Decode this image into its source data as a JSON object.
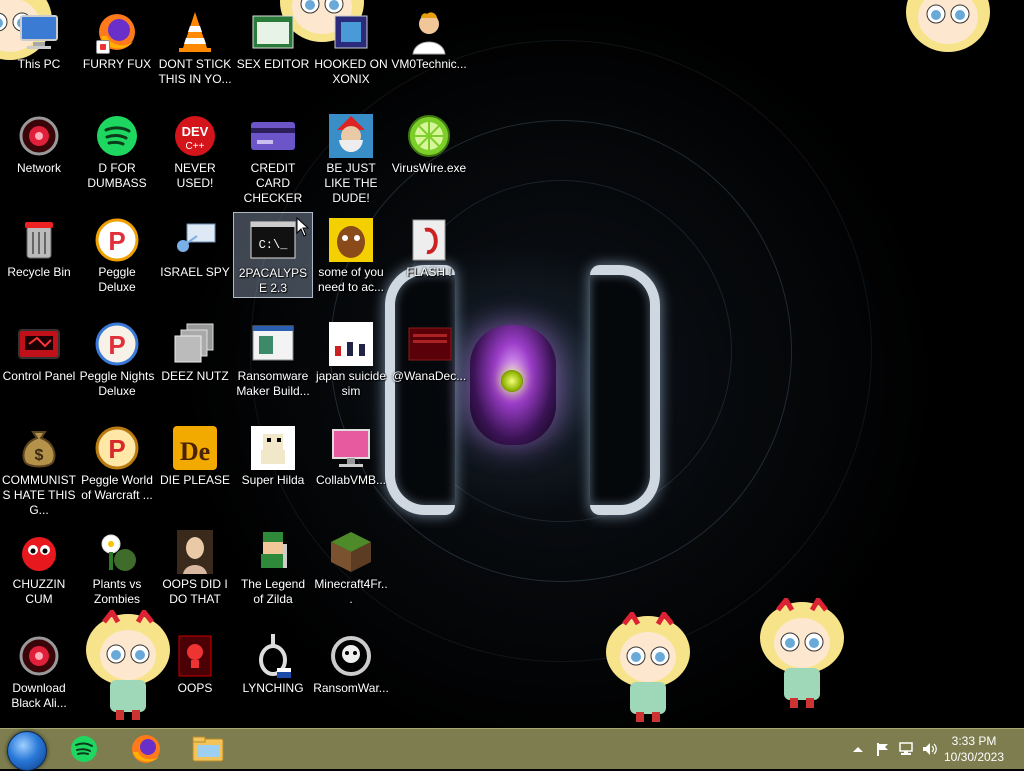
{
  "desktop": {
    "icons": [
      {
        "label": "This PC",
        "icon": "computer-icon"
      },
      {
        "label": "Network",
        "icon": "network-icon"
      },
      {
        "label": "Recycle Bin",
        "icon": "recycle-bin-icon"
      },
      {
        "label": "Control Panel",
        "icon": "control-panel-icon"
      },
      {
        "label": "COMMUNISTS HATE THIS G...",
        "icon": "money-bag-icon"
      },
      {
        "label": "CHUZZIN CUM",
        "icon": "chuzzle-icon"
      },
      {
        "label": "Download Black Ali...",
        "icon": "red-orb-icon"
      },
      {
        "label": "FURRY FUX",
        "icon": "firefox-icon"
      },
      {
        "label": "D FOR DUMBASS",
        "icon": "spotify-icon"
      },
      {
        "label": "Peggle Deluxe",
        "icon": "peggle-icon"
      },
      {
        "label": "Peggle Nights Deluxe",
        "icon": "peggle-nights-icon"
      },
      {
        "label": "Peggle World of Warcraft ...",
        "icon": "peggle-wow-icon"
      },
      {
        "label": "Plants vs Zombies",
        "icon": "plants-vs-zombies-icon"
      },
      {
        "label": "DONT STICK THIS IN YO...",
        "icon": "vlc-cone-icon"
      },
      {
        "label": "NEVER USED!",
        "icon": "devcpp-icon"
      },
      {
        "label": "ISRAEL SPY",
        "icon": "network-spy-icon"
      },
      {
        "label": "DEEZ NUTZ",
        "icon": "stacked-windows-icon"
      },
      {
        "label": "DIE PLEASE",
        "icon": "de-icon"
      },
      {
        "label": "OOPS DID I DO THAT",
        "icon": "portrait-icon"
      },
      {
        "label": "OOPS",
        "icon": "red-skull-icon"
      },
      {
        "label": "SEX EDITOR",
        "icon": "hex-editor-icon"
      },
      {
        "label": "CREDIT CARD CHECKER",
        "icon": "credit-card-icon"
      },
      {
        "label": "2PACALYPSE 2.3",
        "icon": "terminal-icon"
      },
      {
        "label": "Ransomware Maker Build...",
        "icon": "window-app-icon"
      },
      {
        "label": "Super Hilda",
        "icon": "pixel-dog-icon"
      },
      {
        "label": "The Legend of Zilda",
        "icon": "pixel-hero-icon"
      },
      {
        "label": "LYNCHING",
        "icon": "noose-icon"
      },
      {
        "label": "HOOKED ON XONIX",
        "icon": "xonix-icon"
      },
      {
        "label": "BE JUST LIKE THE DUDE!",
        "icon": "santa-icon"
      },
      {
        "label": "some of you need to ac...",
        "icon": "moose-icon"
      },
      {
        "label": "japan suicide sim",
        "icon": "japan-sim-icon"
      },
      {
        "label": "CollabVMB...",
        "icon": "pink-monitor-icon"
      },
      {
        "label": "Minecraft4Fr...",
        "icon": "grass-block-icon"
      },
      {
        "label": "RansomWar...",
        "icon": "skull-ring-icon"
      },
      {
        "label": "VM0Technic...",
        "icon": "doctor-icon"
      },
      {
        "label": "VirusWire.exe",
        "icon": "limewire-icon"
      },
      {
        "label": "FLASH !",
        "icon": "flash-icon"
      },
      {
        "label": "@WanaDec...",
        "icon": "wannadecryptor-icon"
      }
    ]
  },
  "taskbar": {
    "start": "start-orb-icon",
    "pinned": [
      "spotify-icon",
      "firefox-icon",
      "file-explorer-icon"
    ],
    "tray": [
      "show-hidden-icons-icon",
      "action-center-flag-icon",
      "network-tray-icon",
      "volume-icon"
    ],
    "time": "3:33 PM",
    "date": "10/30/2023"
  },
  "colors": {
    "taskbar": "#7d7d4f",
    "selection": "#b4c8e6"
  }
}
